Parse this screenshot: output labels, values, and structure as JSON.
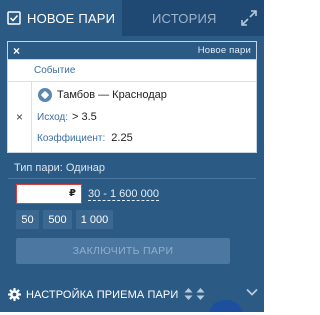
{
  "tabs": {
    "active_label": "НОВОЕ ПАРИ",
    "inactive_label": "ИСТОРИЯ"
  },
  "slip": {
    "header_title": "Новое пари",
    "column_header": "Событие",
    "event": {
      "teams": "Тамбов — Краснодар",
      "outcome_label": "Исход:",
      "outcome_value": "> 3.5",
      "coef_label": "Коэффициент:",
      "coef_value": "2.25"
    }
  },
  "bet_type": "Тип пари: Одинар",
  "stake": {
    "value": "",
    "currency": "₽",
    "range": "30 - 1 600 000",
    "quick_amounts": [
      "50",
      "500",
      "1 000"
    ]
  },
  "place_bet_label": "ЗАКЛЮЧИТЬ ПАРИ",
  "footer": {
    "settings_label": "НАСТРОЙКА ПРИЕМА ПАРИ"
  },
  "colors": {
    "panel": "#2b5a85",
    "tab_inactive": "#1f4873",
    "accent_error": "#d64040"
  }
}
